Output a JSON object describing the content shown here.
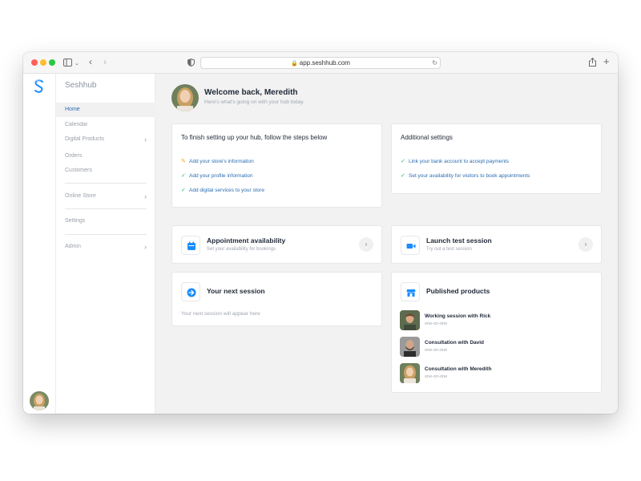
{
  "browser": {
    "url": "app.seshhub.com"
  },
  "sidebar": {
    "brand": "Seshhub",
    "items": [
      {
        "label": "Home",
        "chevron": false
      },
      {
        "label": "Calendar",
        "chevron": false
      },
      {
        "label": "Digital Products",
        "chevron": true
      },
      {
        "label": "Orders",
        "chevron": false
      },
      {
        "label": "Customers",
        "chevron": false
      },
      {
        "label": "Online Store",
        "chevron": true
      },
      {
        "label": "Settings",
        "chevron": false
      },
      {
        "label": "Admin",
        "chevron": true
      }
    ],
    "active": "Home"
  },
  "welcome": {
    "title": "Welcome back, Meredith",
    "subtitle": "Here's what's going on with your hub today."
  },
  "setup": {
    "title": "To finish setting up your hub, follow the steps below",
    "steps": [
      {
        "label": "Add your store's information",
        "status": "in-progress"
      },
      {
        "label": "Add your profile information",
        "status": "done"
      },
      {
        "label": "Add digital services to your store",
        "status": "done"
      }
    ]
  },
  "additional": {
    "title": "Additional settings",
    "steps": [
      {
        "label": "Link your bank account to accept payments",
        "status": "done"
      },
      {
        "label": "Set your availability for visitors to book appointments",
        "status": "done"
      }
    ]
  },
  "appointment": {
    "title": "Appointment availability",
    "subtitle": "Set your availability for bookings",
    "icon": "calendar-icon"
  },
  "launch": {
    "title": "Launch test session",
    "subtitle": "Try out a test session",
    "icon": "video-icon"
  },
  "next_session": {
    "title": "Your next session",
    "placeholder": "Your next session will appear here",
    "icon": "arrow-right-circle-icon"
  },
  "published": {
    "title": "Published products",
    "icon": "store-icon",
    "products": [
      {
        "name": "Working session with Rick",
        "type": "one-on-one"
      },
      {
        "name": "Consultation with David",
        "type": "one-on-one"
      },
      {
        "name": "Consultation with Meredith",
        "type": "one-on-one"
      }
    ]
  },
  "colors": {
    "accent": "#2b6cb0",
    "icon_blue": "#1a8cff",
    "check_green": "#22b573",
    "pencil_orange": "#f0a020"
  }
}
